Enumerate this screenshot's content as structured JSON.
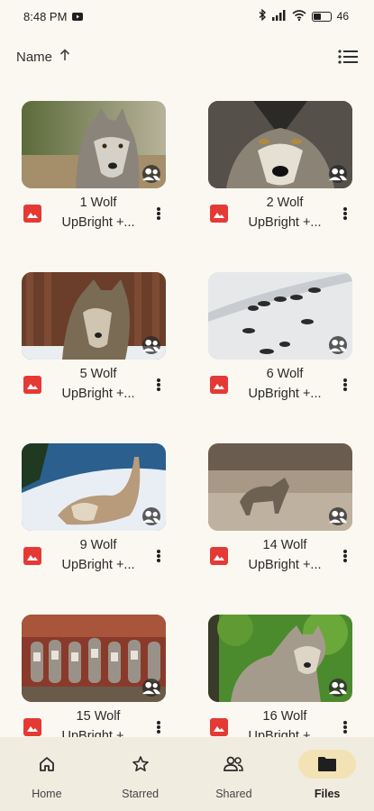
{
  "status_bar": {
    "time": "8:48 PM",
    "battery": "46"
  },
  "sort": {
    "label": "Name",
    "direction_icon": "arrow-up-icon",
    "view_icon": "list-view-icon"
  },
  "files": [
    {
      "name": "1 Wolf",
      "subtitle": "UpBright +...",
      "type_icon": "image-file-icon",
      "shared": true
    },
    {
      "name": "2 Wolf",
      "subtitle": "UpBright +...",
      "type_icon": "image-file-icon",
      "shared": true
    },
    {
      "name": "5 Wolf",
      "subtitle": "UpBright +...",
      "type_icon": "image-file-icon",
      "shared": true
    },
    {
      "name": "6 Wolf",
      "subtitle": "UpBright +...",
      "type_icon": "image-file-icon",
      "shared": true
    },
    {
      "name": "9 Wolf",
      "subtitle": "UpBright +...",
      "type_icon": "image-file-icon",
      "shared": true
    },
    {
      "name": "14 Wolf",
      "subtitle": "UpBright +...",
      "type_icon": "image-file-icon",
      "shared": true
    },
    {
      "name": "15 Wolf",
      "subtitle": "UpBright +...",
      "type_icon": "image-file-icon",
      "shared": true
    },
    {
      "name": "16 Wolf",
      "subtitle": "UpBright +...",
      "type_icon": "image-file-icon",
      "shared": true
    }
  ],
  "nav": {
    "items": [
      {
        "label": "Home",
        "icon": "home-icon",
        "active": false
      },
      {
        "label": "Starred",
        "icon": "star-icon",
        "active": false
      },
      {
        "label": "Shared",
        "icon": "shared-people-icon",
        "active": false
      },
      {
        "label": "Files",
        "icon": "folder-icon",
        "active": true
      }
    ]
  },
  "colors": {
    "background": "#fbf8f1",
    "nav_background": "#f1ece0",
    "active_pill": "#f3e2b4",
    "file_icon_red": "#e53935"
  }
}
